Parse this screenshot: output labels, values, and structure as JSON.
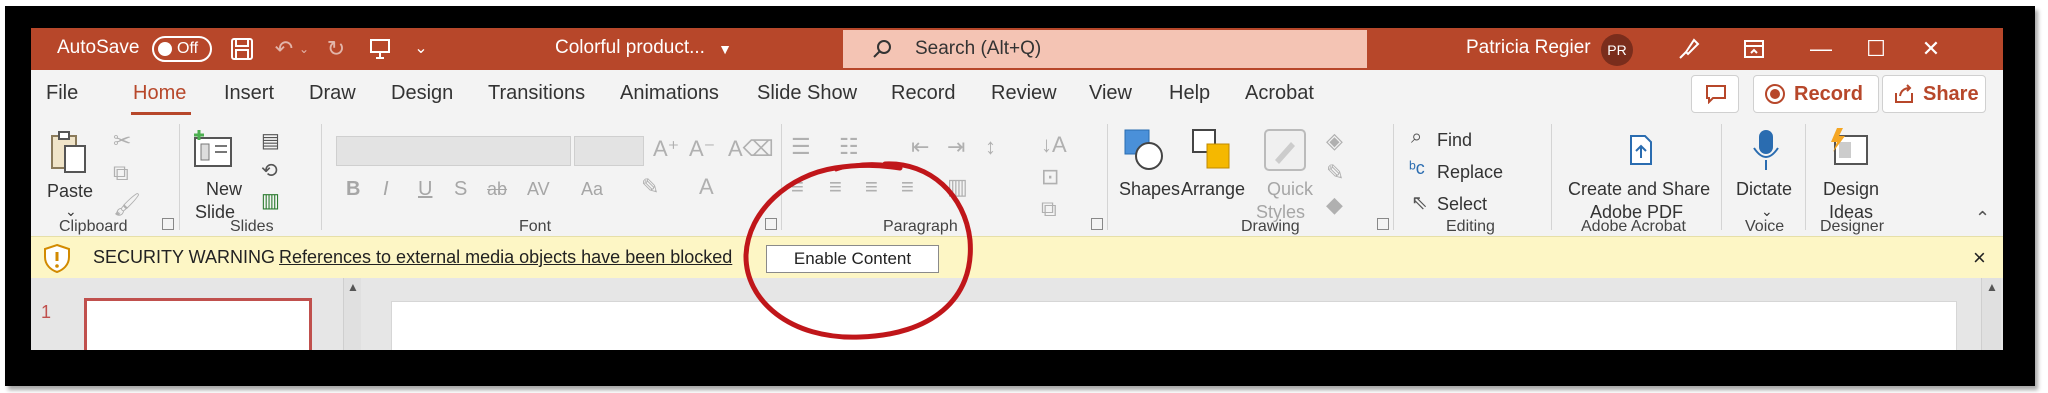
{
  "titlebar": {
    "autosave_label": "AutoSave",
    "autosave_state": "Off",
    "doc_title": "Colorful product...",
    "search_placeholder": "Search (Alt+Q)",
    "user_name": "Patricia Regier",
    "user_initials": "PR"
  },
  "menu": {
    "tabs": [
      "File",
      "Home",
      "Insert",
      "Draw",
      "Design",
      "Transitions",
      "Animations",
      "Slide Show",
      "Record",
      "Review",
      "View",
      "Help",
      "Acrobat"
    ],
    "active_tab": "Home",
    "record_label": "Record",
    "share_label": "Share"
  },
  "ribbon": {
    "paste_label": "Paste",
    "new_slide_label_1": "New",
    "new_slide_label_2": "Slide",
    "font_buttons": [
      "B",
      "I",
      "U",
      "S",
      "ab",
      "AV",
      "Aa"
    ],
    "shapes_label": "Shapes",
    "arrange_label": "Arrange",
    "quick_styles_label_1": "Quick",
    "quick_styles_label_2": "Styles",
    "find_label": "Find",
    "replace_label": "Replace",
    "select_label": "Select",
    "create_share_label_1": "Create and Share",
    "create_share_label_2": "Adobe PDF",
    "dictate_label": "Dictate",
    "design_ideas_label_1": "Design",
    "design_ideas_label_2": "Ideas",
    "groups": {
      "clipboard": "Clipboard",
      "slides": "Slides",
      "font": "Font",
      "paragraph": "Paragraph",
      "drawing": "Drawing",
      "editing": "Editing",
      "adobe_acrobat": "Adobe Acrobat",
      "voice": "Voice",
      "designer": "Designer"
    }
  },
  "security_bar": {
    "title": "SECURITY WARNING",
    "message": "References to external media objects have been blocked",
    "button_label": "Enable Content",
    "close_glyph": "×"
  },
  "slides_panel": {
    "slide_number": "1"
  },
  "colors": {
    "brand": "#b7472a",
    "search_bg": "#f4c4b4",
    "warning_bg": "#fdf6c5",
    "annotation": "#c0161a"
  },
  "icons": {
    "undo": "undo-icon",
    "redo": "redo-icon",
    "save": "save-icon",
    "search": "search-icon",
    "warning": "shield-warning-icon"
  }
}
